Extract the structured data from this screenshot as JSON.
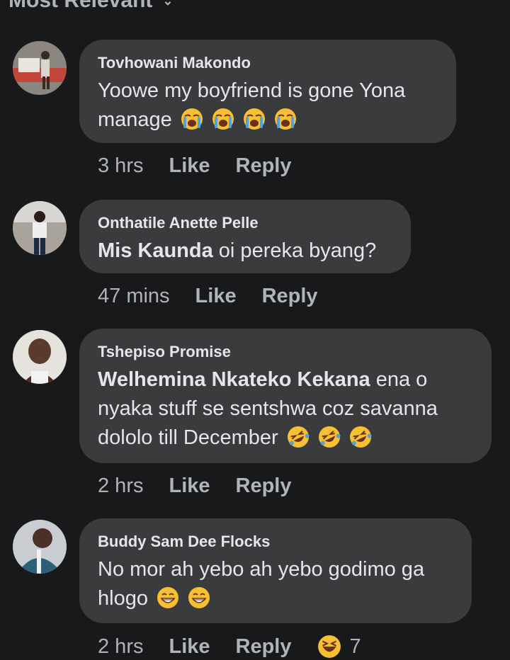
{
  "sort": {
    "label": "Most Relevant"
  },
  "comments": [
    {
      "author": "Tovhowani Makondo",
      "mention": "",
      "text": "Yoowe my boyfriend is gone Yona manage",
      "emoji": "loudly-crying-face",
      "emoji_count": 4,
      "time": "3 hrs",
      "like": "Like",
      "reply": "Reply"
    },
    {
      "author": "Onthatile Anette Pelle",
      "mention": "Mis Kaunda",
      "text": " oi pereka byang?",
      "emoji": "",
      "emoji_count": 0,
      "time": "47 mins",
      "like": "Like",
      "reply": "Reply"
    },
    {
      "author": "Tshepiso Promise",
      "mention": "Welhemina Nkateko Kekana",
      "text": " ena o nyaka stuff se sentshwa coz savanna dololo till December",
      "emoji": "rolling-on-floor-laughing",
      "emoji_count": 3,
      "time": "2 hrs",
      "like": "Like",
      "reply": "Reply"
    },
    {
      "author": "Buddy Sam Dee Flocks",
      "mention": "",
      "text": "No mor ah yebo ah yebo godimo ga hlogo",
      "emoji": "beaming-face",
      "emoji_count": 2,
      "time": "2 hrs",
      "like": "Like",
      "reply": "Reply",
      "reaction": {
        "icon": "haha-reaction",
        "count": "7"
      }
    }
  ]
}
